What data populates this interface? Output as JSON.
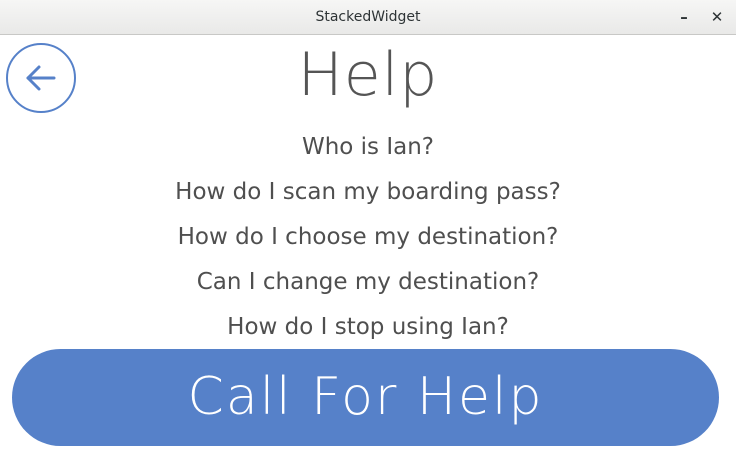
{
  "window": {
    "title": "StackedWidget",
    "minimize_label": "–",
    "close_label": "✕"
  },
  "back_button": {
    "icon": "arrow-left-icon"
  },
  "header": {
    "title": "Help"
  },
  "faq": {
    "items": [
      "Who is Ian?",
      "How do I scan my boarding pass?",
      "How do I choose my destination?",
      "Can I change my destination?",
      "How do I stop using Ian?"
    ]
  },
  "call_button": {
    "label": "Call For Help"
  },
  "colors": {
    "accent": "#5681c9",
    "text": "#555555",
    "background": "#ffffff"
  }
}
